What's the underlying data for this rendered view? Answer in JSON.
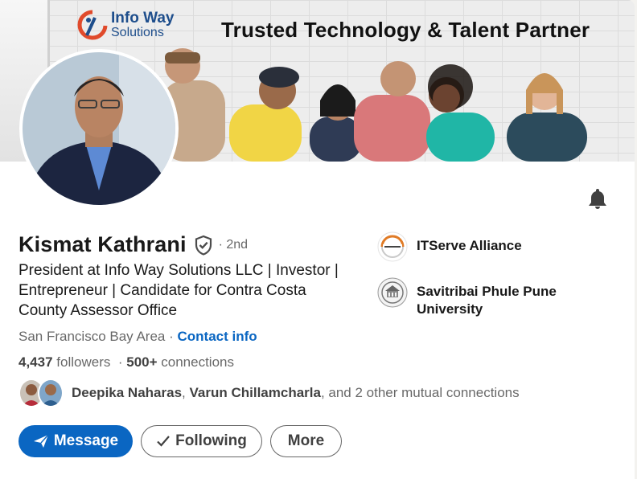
{
  "banner": {
    "headline": "Trusted Technology & Talent Partner",
    "brand_line1": "Info Way",
    "brand_line2": "Solutions"
  },
  "profile": {
    "name": "Kismat Kathrani",
    "degree": "· 2nd",
    "headline": "President at Info Way Solutions LLC | Investor | Entrepreneur | Candidate for Contra Costa County Assessor Office",
    "location": "San Francisco Bay Area ·",
    "contact_label": "Contact info",
    "followers_count": "4,437",
    "followers_label": "followers",
    "connections_count": "500+",
    "connections_label": "connections",
    "connections_sep": "·"
  },
  "mutual": {
    "name1": "Deepika Naharas",
    "sep": ",",
    "name2": "Varun Chillamcharla",
    "rest": ", and 2 other mutual connections"
  },
  "actions": {
    "message": "Message",
    "following": "Following",
    "more": "More"
  },
  "orgs": [
    {
      "name": "ITServe Alliance",
      "icon": "itserve-logo"
    },
    {
      "name": "Savitribai Phule Pune University",
      "icon": "university-seal-logo"
    }
  ],
  "colors": {
    "primary": "#0a66c2",
    "brand_blue": "#1e4e8c",
    "brand_red": "#e04a2b"
  },
  "icons": {
    "bell": "bell-icon",
    "verified": "verified-shield-icon",
    "message": "send-arrow-icon",
    "following": "checkmark-icon"
  }
}
